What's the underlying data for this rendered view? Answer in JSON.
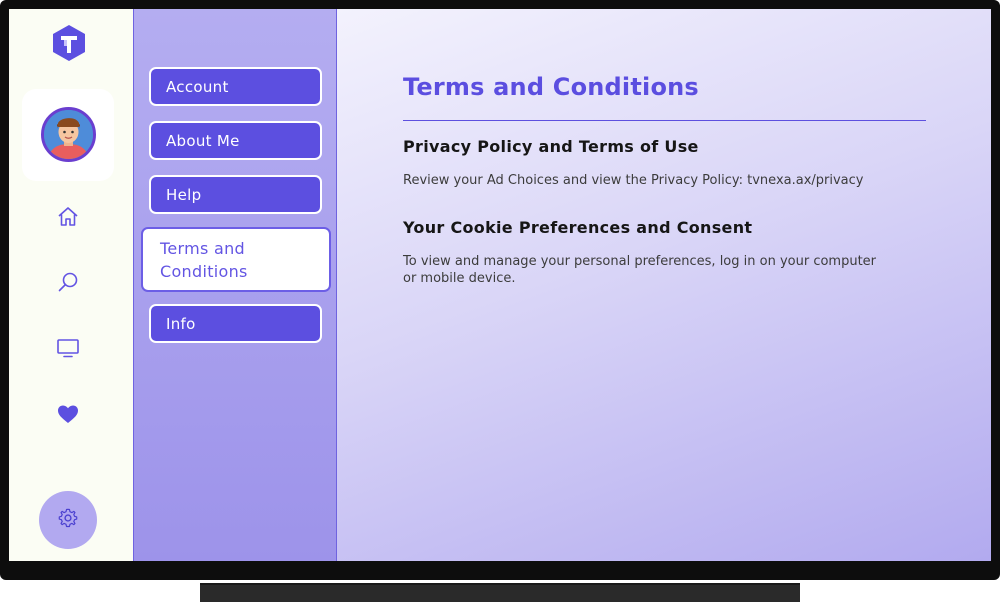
{
  "app": {
    "logo_icon": "tvnexa-t-hexagon-logo",
    "avatar_icon": "user-avatar-icon"
  },
  "rail": {
    "items": [
      {
        "icon": "home-icon"
      },
      {
        "icon": "search-icon"
      },
      {
        "icon": "tv-icon"
      },
      {
        "icon": "heart-icon"
      }
    ],
    "settings_icon": "gear-icon"
  },
  "menu": {
    "items": [
      {
        "label": "Account"
      },
      {
        "label": "About Me"
      },
      {
        "label": "Help"
      },
      {
        "label": "Terms and Conditions",
        "active": true
      },
      {
        "label": "Info"
      }
    ]
  },
  "main": {
    "title": "Terms and Conditions",
    "sections": [
      {
        "heading": "Privacy Policy and Terms of Use",
        "body": "Review your Ad Choices and view the Privacy Policy: tvnexa.ax/privacy"
      },
      {
        "heading": "Your Cookie Preferences and Consent",
        "body": "To view and manage your personal preferences, log in on your computer or mobile device."
      }
    ]
  },
  "colors": {
    "accent": "#5c4fe0",
    "rail_bg": "#fbfdf4",
    "menu_bg": "#a89ff0",
    "content_bg_end": "#b2aaef"
  }
}
